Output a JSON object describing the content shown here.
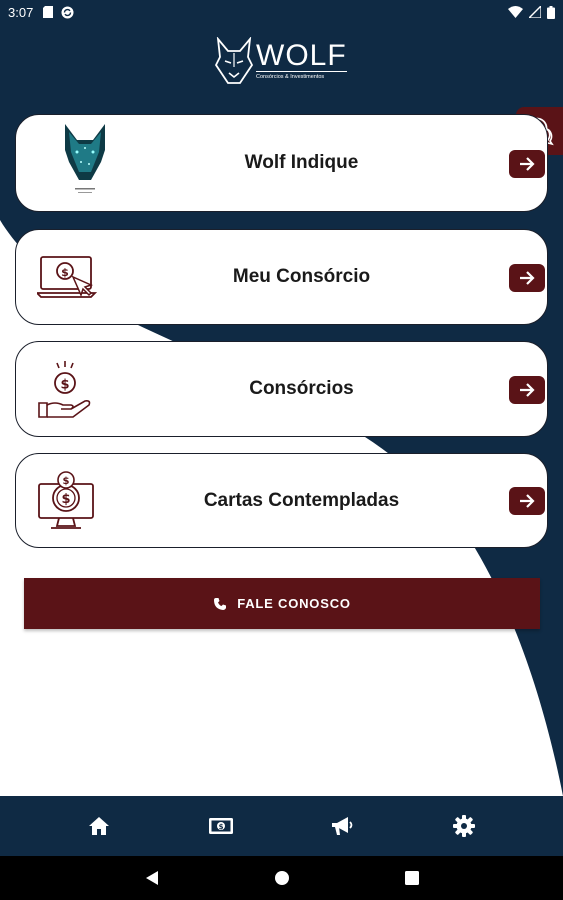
{
  "status_bar": {
    "time": "3:07",
    "left_icons": [
      "sd-card-icon",
      "sync-icon"
    ],
    "right_icons": [
      "wifi-icon",
      "signal-icon",
      "battery-icon"
    ]
  },
  "brand": {
    "name": "WOLF",
    "tagline": "Consórcios & Investimentos",
    "colors": {
      "navy": "#0f2a44",
      "wine": "#5a1317",
      "white": "#ffffff"
    }
  },
  "help": {
    "icon": "chat-help-icon"
  },
  "menu": {
    "items": [
      {
        "label": "Wolf Indique",
        "icon": "wolf-logo-icon"
      },
      {
        "label": "Meu Consórcio",
        "icon": "monitor-dollar-icon"
      },
      {
        "label": "Consórcios",
        "icon": "hand-coin-icon"
      },
      {
        "label": "Cartas Contempladas",
        "icon": "computer-coins-icon"
      }
    ]
  },
  "contact": {
    "label": "FALE CONOSCO",
    "icon": "phone-icon"
  },
  "bottom_nav": {
    "items": [
      {
        "icon": "home-icon"
      },
      {
        "icon": "money-icon"
      },
      {
        "icon": "megaphone-icon"
      },
      {
        "icon": "gear-icon"
      }
    ]
  },
  "system_nav": {
    "items": [
      "back-icon",
      "home-circle-icon",
      "recents-icon"
    ]
  }
}
